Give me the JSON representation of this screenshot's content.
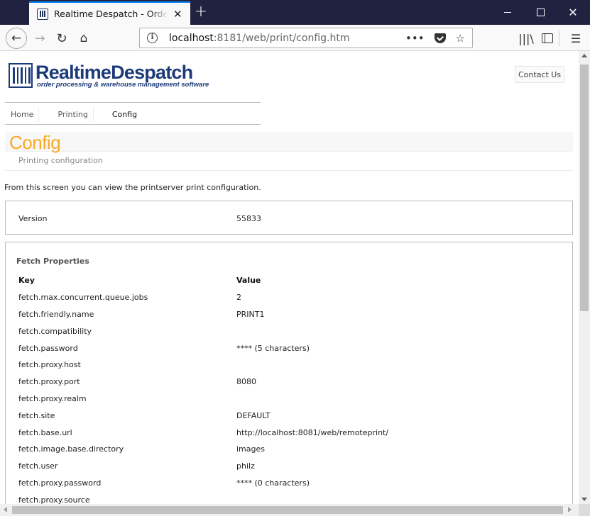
{
  "browser": {
    "tab_title": "Realtime Despatch - Order processing & warehouse management software",
    "url_host": "localhost",
    "url_rest": ":8181/web/print/config.htm"
  },
  "header": {
    "logo_name": "RealtimeDespatch",
    "logo_tagline": "order processing & warehouse management software",
    "contact_label": "Contact Us"
  },
  "nav": {
    "items": [
      "Home",
      "Printing",
      "Config"
    ]
  },
  "page": {
    "title": "Config",
    "subtitle": "Printing configuration",
    "intro": "From this screen you can view the printserver print configuration."
  },
  "version": {
    "label": "Version",
    "value": "55833"
  },
  "fetch": {
    "section_title": "Fetch Properties",
    "key_header": "Key",
    "value_header": "Value",
    "rows": [
      {
        "key": "fetch.max.concurrent.queue.jobs",
        "value": "2"
      },
      {
        "key": "fetch.friendly.name",
        "value": "PRINT1"
      },
      {
        "key": "fetch.compatibility",
        "value": ""
      },
      {
        "key": "fetch.password",
        "value": "**** (5 characters)"
      },
      {
        "key": "fetch.proxy.host",
        "value": ""
      },
      {
        "key": "fetch.proxy.port",
        "value": "8080"
      },
      {
        "key": "fetch.proxy.realm",
        "value": ""
      },
      {
        "key": "fetch.site",
        "value": "DEFAULT"
      },
      {
        "key": "fetch.base.url",
        "value": "http://localhost:8081/web/remoteprint/"
      },
      {
        "key": "fetch.image.base.directory",
        "value": "images"
      },
      {
        "key": "fetch.user",
        "value": "philz"
      },
      {
        "key": "fetch.proxy.password",
        "value": "**** (0 characters)"
      },
      {
        "key": "fetch.proxy.source",
        "value": ""
      }
    ]
  },
  "colors": {
    "brand_blue": "#1c3b7a",
    "title_orange": "#f7a928"
  }
}
